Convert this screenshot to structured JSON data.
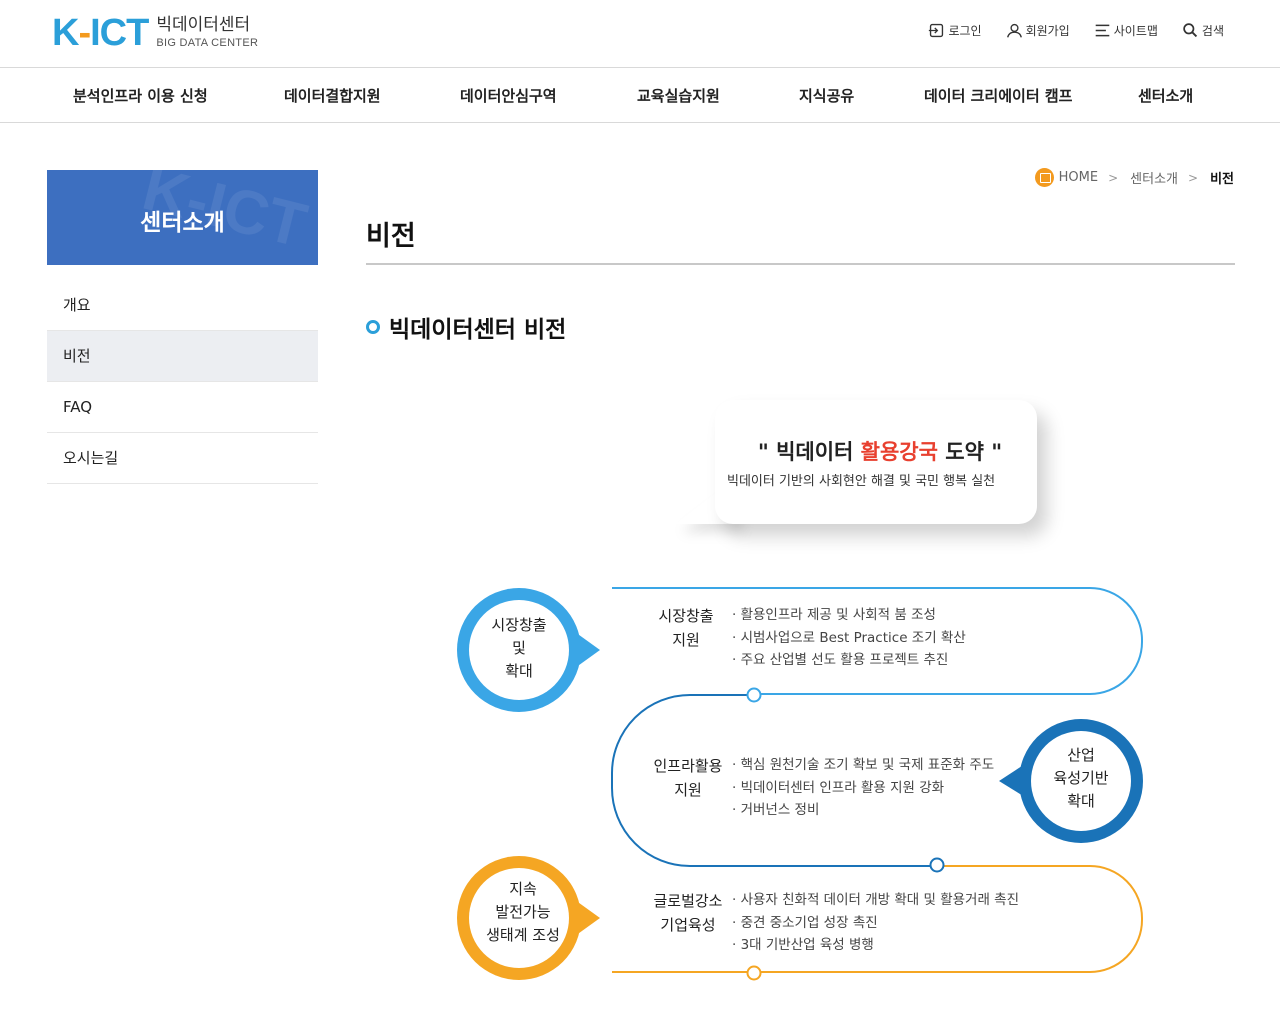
{
  "header": {
    "logo": {
      "k": "K",
      "dash": "-",
      "ict": "ICT",
      "title_kr": "빅데이터센터",
      "title_en": "BIG DATA CENTER"
    },
    "util": [
      {
        "label": "로그인",
        "icon": "login-icon"
      },
      {
        "label": "회원가입",
        "icon": "user-icon"
      },
      {
        "label": "사이트맵",
        "icon": "menu-icon"
      },
      {
        "label": "검색",
        "icon": "search-icon"
      }
    ],
    "gnb": [
      "분석인프라 이용 신청",
      "데이터결합지원",
      "데이터안심구역",
      "교육실습지원",
      "지식공유",
      "데이터 크리에이터 캠프",
      "센터소개"
    ]
  },
  "sidebar": {
    "title": "센터소개",
    "watermark": "K-ICT",
    "items": [
      {
        "label": "개요",
        "active": false
      },
      {
        "label": "비전",
        "active": true
      },
      {
        "label": "FAQ",
        "active": false
      },
      {
        "label": "오시는길",
        "active": false
      }
    ]
  },
  "breadcrumb": {
    "home": "HOME",
    "parent": "센터소개",
    "current": "비전"
  },
  "page": {
    "title": "비전",
    "section_title": "빅데이터센터 비전"
  },
  "vision": {
    "quote_open": "\" 빅데이터 ",
    "quote_em": "활용강국",
    "quote_close": " 도약 \"",
    "sub": "빅데이터 기반의 사회현안 해결 및 국민 행복 실천"
  },
  "diagram": {
    "circles": [
      {
        "label_lines": [
          "시장창출",
          "및",
          "확대"
        ],
        "color": "#3aa6e6"
      },
      {
        "label_lines": [
          "산업",
          "육성기반",
          "확대"
        ],
        "color": "#1a73b8"
      },
      {
        "label_lines": [
          "지속",
          "발전가능",
          "생태계 조성"
        ],
        "color": "#f5a623"
      }
    ],
    "rows": [
      {
        "title_lines": [
          "시장창출",
          "지원"
        ],
        "items": [
          "· 활용인프라 제공 및 사회적 붐 조성",
          "· 시범사업으로 Best Practice 조기 확산",
          "· 주요 산업별 선도 활용 프로젝트 추진"
        ]
      },
      {
        "title_lines": [
          "인프라활용",
          "지원"
        ],
        "items": [
          "· 핵심 원천기술 조기 확보 및 국제 표준화 주도",
          "· 빅데이터센터 인프라 활용 지원 강화",
          "· 거버넌스 정비"
        ]
      },
      {
        "title_lines": [
          "글로벌강소",
          "기업육성"
        ],
        "items": [
          "· 사용자 친화적 데이터 개방 확대 및 활용거래 촉진",
          "· 중견 중소기업 성장 촉진",
          "· 3대 기반산업 육성 병행"
        ]
      }
    ]
  },
  "colors": {
    "brand_blue": "#2b9fd9",
    "brand_orange": "#f39a1e",
    "sidebar_bg": "#3d6fc0",
    "accent_red": "#e8402f"
  }
}
